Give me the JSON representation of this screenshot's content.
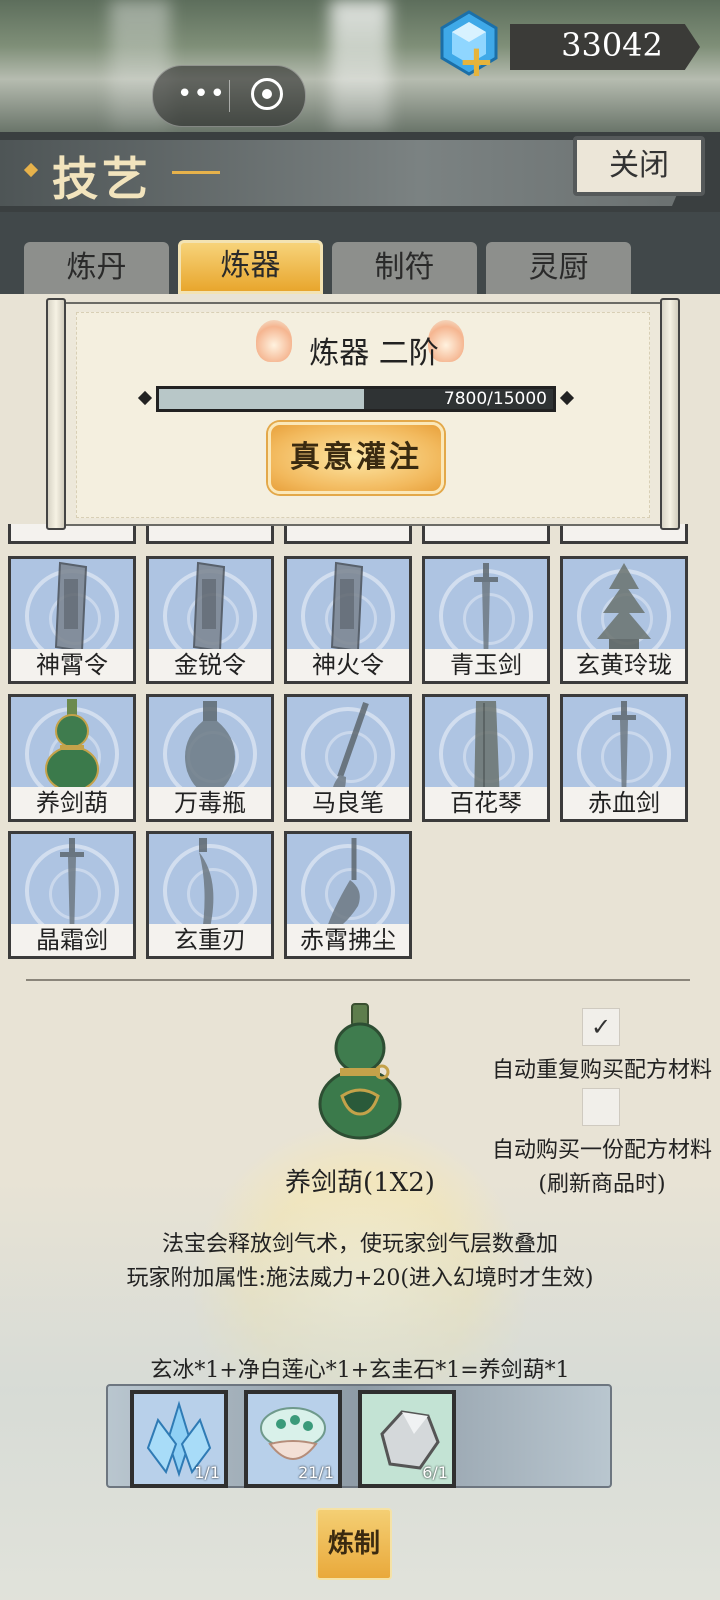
{
  "capsule": {
    "menu_label": "•••"
  },
  "currency": {
    "amount": "33042",
    "icon": "blue-gem-icon"
  },
  "header": {
    "title": "技艺",
    "close_label": "关闭"
  },
  "tabs": [
    {
      "label": "炼丹",
      "active": false
    },
    {
      "label": "炼器",
      "active": true
    },
    {
      "label": "制符",
      "active": false
    },
    {
      "label": "灵厨",
      "active": false
    }
  ],
  "rank": {
    "title": "炼器 二阶",
    "progress_text": "7800/15000",
    "progress_current": 7800,
    "progress_max": 15000,
    "infuse_label": "真意灌注"
  },
  "items": [
    {
      "name": "神霄令",
      "icon": "token-icon"
    },
    {
      "name": "金锐令",
      "icon": "token-icon"
    },
    {
      "name": "神火令",
      "icon": "token-icon"
    },
    {
      "name": "青玉剑",
      "icon": "sword-icon"
    },
    {
      "name": "玄黄玲珑",
      "icon": "pagoda-icon"
    },
    {
      "name": "养剑葫",
      "icon": "gourd-icon"
    },
    {
      "name": "万毒瓶",
      "icon": "vase-icon"
    },
    {
      "name": "马良笔",
      "icon": "brush-icon"
    },
    {
      "name": "百花琴",
      "icon": "zither-icon"
    },
    {
      "name": "赤血剑",
      "icon": "sword-icon"
    },
    {
      "name": "晶霜剑",
      "icon": "sword-icon"
    },
    {
      "name": "玄重刃",
      "icon": "blade-icon"
    },
    {
      "name": "赤霄拂尘",
      "icon": "whisk-icon"
    }
  ],
  "detail": {
    "name": "养剑葫(1X2)",
    "desc1": "法宝会释放剑气术，使玩家剑气层数叠加",
    "desc2": "玩家附加属性:施法威力+20(进入幻境时才生效)",
    "recipe": "玄冰*1+净白莲心*1+玄圭石*1=养剑葫*1",
    "craft_label": "炼制"
  },
  "options": [
    {
      "label": "自动重复购买配方材料",
      "checked": true
    },
    {
      "label": "自动购买一份配方材料",
      "sublabel": "(刷新商品时)",
      "checked": false
    }
  ],
  "materials": [
    {
      "count": "1/1",
      "icon": "ice-crystal-icon"
    },
    {
      "count": "21/1",
      "icon": "lotus-heart-icon"
    },
    {
      "count": "6/1",
      "icon": "stone-icon"
    }
  ],
  "colors": {
    "accent": "#e8a62d",
    "tile": "#aec4e2",
    "dark": "#3b3b3b"
  }
}
